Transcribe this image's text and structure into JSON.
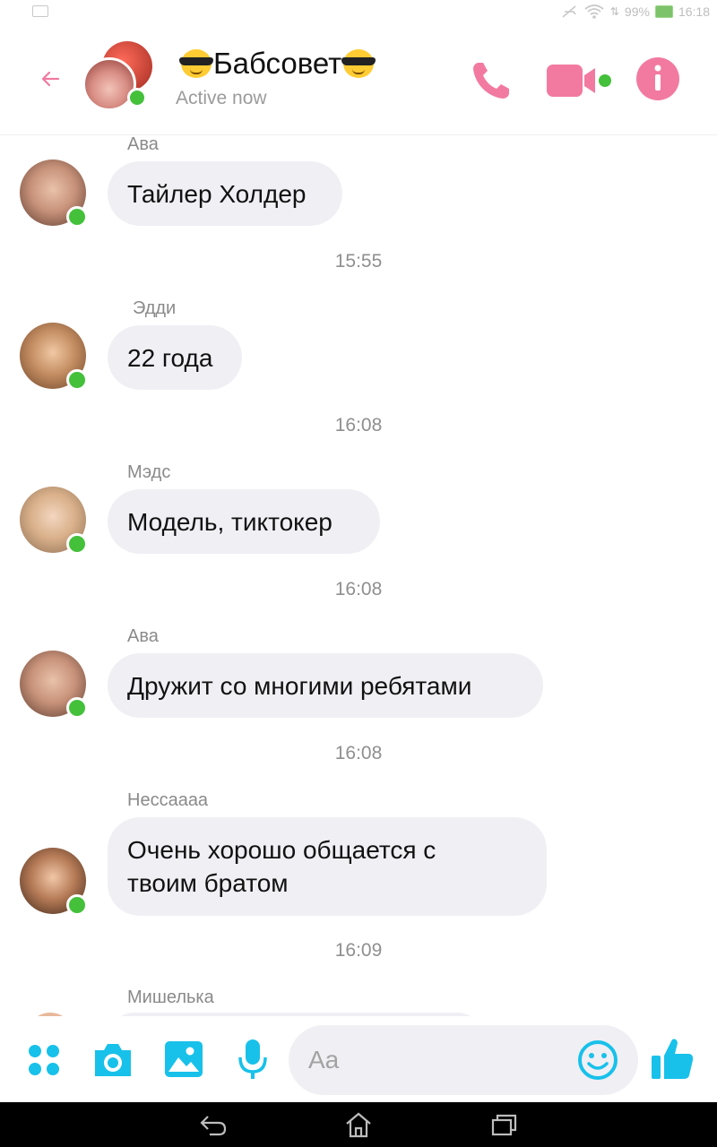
{
  "status_bar": {
    "battery": "99%",
    "time": "16:18"
  },
  "header": {
    "title_text": "Бабсовет",
    "subtitle": "Active now",
    "colors": {
      "accent": "#f27aa0",
      "online": "#44c03b"
    }
  },
  "messages": [
    {
      "sender": "Ава",
      "text": "Тайлер Холдер",
      "time": "15:55"
    },
    {
      "sender": "Эдди",
      "text": "22 года",
      "time": "16:08"
    },
    {
      "sender": "Мэдс",
      "text": "Модель, тиктокер",
      "time": "16:08"
    },
    {
      "sender": "Ава",
      "text": "Дружит со многими ребятами",
      "time": "16:08"
    },
    {
      "sender": "Нессаааа",
      "text_line1": "Очень хорошо общается с",
      "text_line2": "твоим братом",
      "time": "16:09"
    },
    {
      "sender": "Мишелька"
    }
  ],
  "composer": {
    "placeholder": "Aa",
    "accent": "#18c1ea"
  }
}
